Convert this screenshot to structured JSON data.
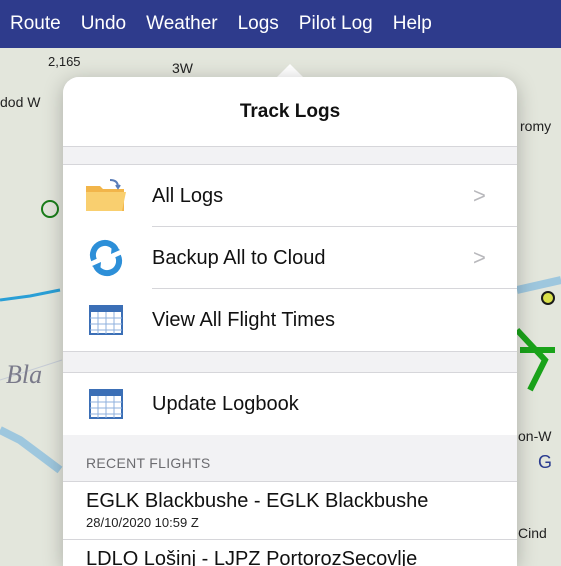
{
  "menu": [
    "Route",
    "Undo",
    "Weather",
    "Logs",
    "Pilot Log",
    "Help"
  ],
  "map": {
    "labels": [
      "2,165",
      "3W",
      "dod W",
      "romy",
      "Bla",
      "on-W",
      "G",
      "Cind"
    ]
  },
  "popover": {
    "title": "Track Logs",
    "items": [
      {
        "label": "All Logs",
        "icon": "folder-icon",
        "chevron": true
      },
      {
        "label": "Backup All to Cloud",
        "icon": "cloud-sync-icon",
        "chevron": true
      },
      {
        "label": "View All Flight Times",
        "icon": "table-icon",
        "chevron": false
      }
    ],
    "item_logbook": {
      "label": "Update Logbook",
      "icon": "table-icon"
    },
    "recent_header": "RECENT FLIGHTS",
    "flights": [
      {
        "route": "EGLK Blackbushe - EGLK Blackbushe",
        "when": "28/10/2020 10:59 Z"
      },
      {
        "route": "LDLO Lošinj - LJPZ PortorozSecovlje",
        "when": ""
      }
    ],
    "chevron": ">"
  }
}
